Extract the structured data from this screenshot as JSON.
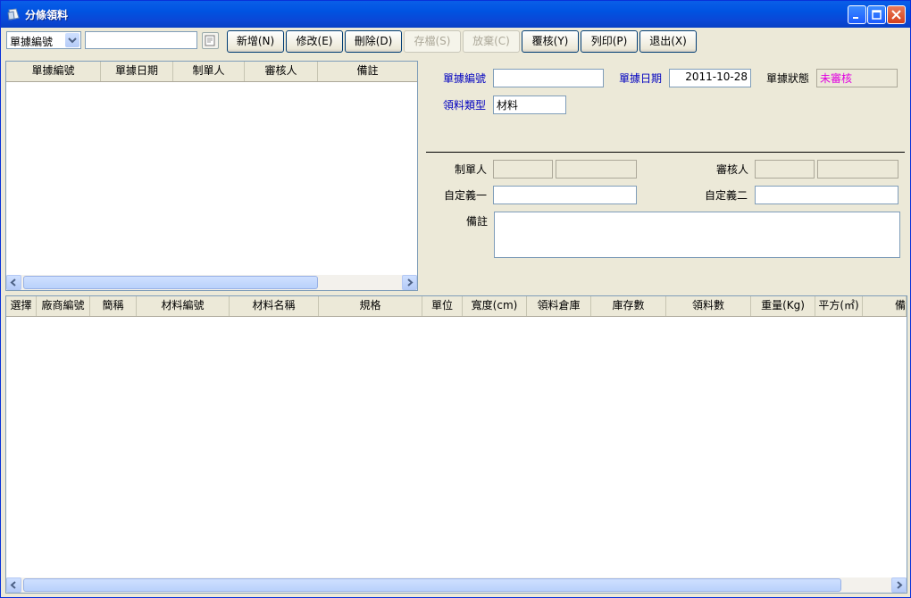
{
  "window": {
    "title": "分條領料"
  },
  "toolbar": {
    "search_field": "單據編號",
    "search_value": "",
    "buttons": {
      "add": "新增(N)",
      "edit": "修改(E)",
      "delete": "刪除(D)",
      "save": "存檔(S)",
      "discard": "放棄(C)",
      "approve": "覆核(Y)",
      "print": "列印(P)",
      "exit": "退出(X)"
    }
  },
  "list_grid": {
    "columns": [
      "單據編號",
      "單據日期",
      "制單人",
      "審核人",
      "備註"
    ]
  },
  "form": {
    "doc_no_label": "單據編號",
    "doc_no_value": "",
    "doc_date_label": "單據日期",
    "doc_date_value": "2011-10-28",
    "doc_status_label": "單據狀態",
    "doc_status_value": "未審核",
    "material_type_label": "領料類型",
    "material_type_value": "材料",
    "maker_label": "制單人",
    "maker_code": "",
    "maker_name": "",
    "reviewer_label": "審核人",
    "reviewer_code": "",
    "reviewer_name": "",
    "custom1_label": "自定義一",
    "custom1_value": "",
    "custom2_label": "自定義二",
    "custom2_value": "",
    "remark_label": "備註",
    "remark_value": ""
  },
  "detail_grid": {
    "columns": [
      "選擇",
      "廠商編號",
      "簡稱",
      "材料編號",
      "材料名稱",
      "規格",
      "單位",
      "寬度(cm)",
      "領料倉庫",
      "庫存數",
      "領料數",
      "重量(Kg)",
      "平方(㎡)",
      "備"
    ]
  },
  "colors": {
    "status_text": "#e000e0",
    "label_blue": "#0000c0",
    "title_bar": "#0053e1"
  }
}
